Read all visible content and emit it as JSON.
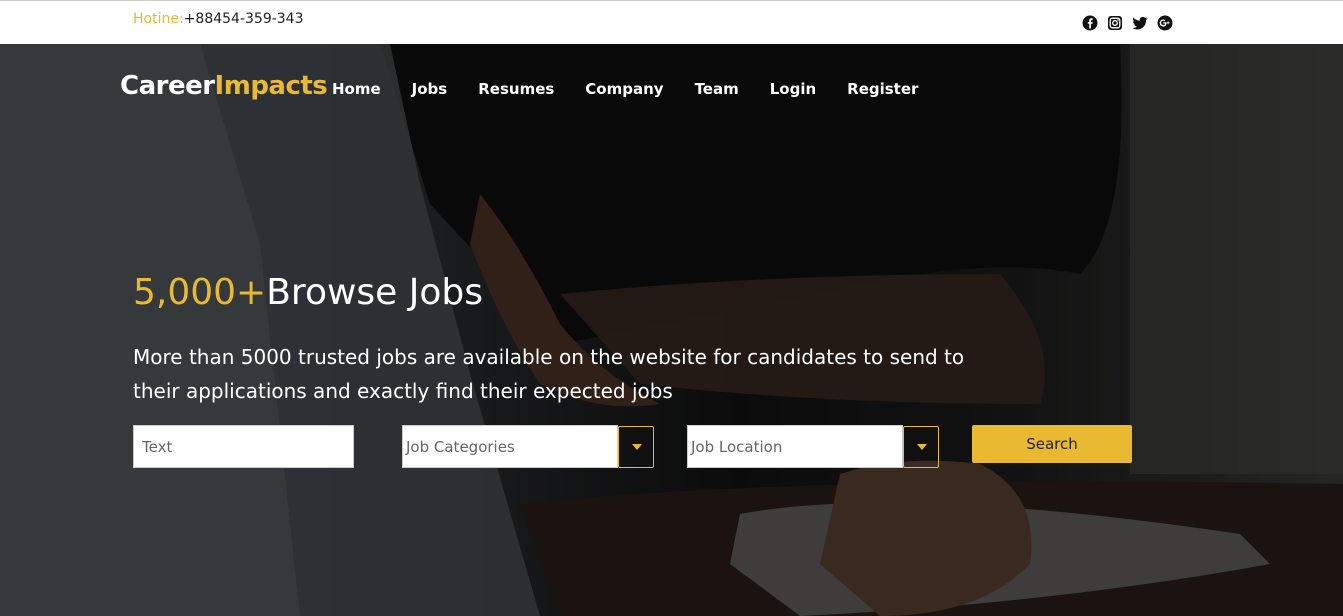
{
  "topbar": {
    "hotline_label": "Hotine:",
    "hotline_number": "+88454-359-343",
    "social_icons": [
      "facebook-icon",
      "instagram-icon",
      "twitter-icon",
      "google-plus-icon"
    ]
  },
  "brand": {
    "part1": "Career",
    "part2": "Impacts"
  },
  "nav": {
    "items": [
      "Home",
      "Jobs",
      "Resumes",
      "Company",
      "Team",
      "Login",
      "Register"
    ]
  },
  "hero": {
    "count": "5,000+",
    "title": "Browse Jobs",
    "description": "More than 5000 trusted jobs are available on the website for candidates to send to their applications and exactly find their expected jobs"
  },
  "search": {
    "text_placeholder": "Text",
    "category_value": "Job Categories",
    "location_value": "Job Location",
    "button_label": "Search"
  },
  "colors": {
    "accent": "#e9b931",
    "topbar_bg": "#ffffff",
    "text_light": "#ffffff"
  }
}
